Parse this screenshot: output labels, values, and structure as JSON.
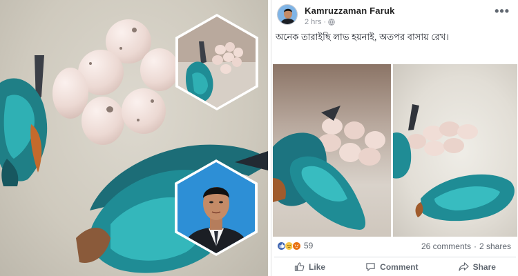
{
  "post": {
    "author": "Kamruzzaman Faruk",
    "time": "2 hrs",
    "separator": "·",
    "more_menu": "•••",
    "caption": "অনেক তারাইছি লাভ হয়নাই, অতপর বাসায় রেখ।",
    "reaction_count": "59",
    "comments": "26 comments",
    "dot": "·",
    "shares": "2 shares"
  },
  "actions": {
    "like": "Like",
    "comment": "Comment",
    "share": "Share"
  },
  "icons": {
    "globe": "globe-icon",
    "like": "like-icon",
    "comment": "comment-icon",
    "share": "share-icon",
    "reactions": [
      "like-reaction-icon",
      "sad-reaction-icon",
      "angry-reaction-icon"
    ]
  },
  "colors": {
    "facebook_blue": "#4267b2",
    "meta_text": "#90949c",
    "action_text": "#606770"
  }
}
